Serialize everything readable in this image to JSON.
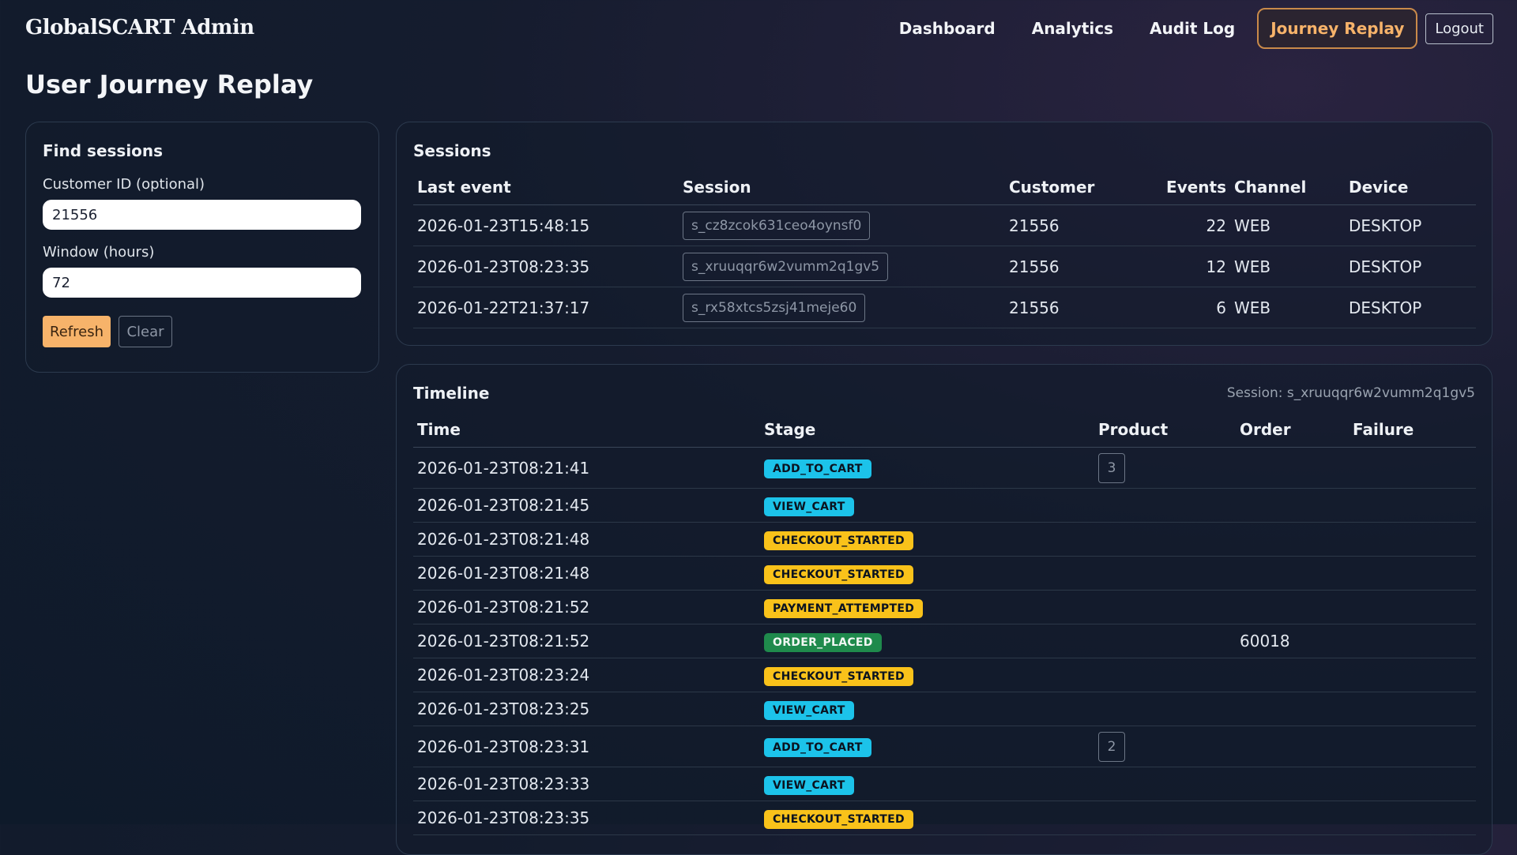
{
  "header": {
    "brand": "GlobalSCART Admin",
    "nav": [
      "Dashboard",
      "Analytics",
      "Audit Log",
      "Journey Replay"
    ],
    "active": "Journey Replay",
    "logout": "Logout"
  },
  "page": {
    "title": "User Journey Replay"
  },
  "find": {
    "title": "Find sessions",
    "customer_label": "Customer ID (optional)",
    "customer_value": "21556",
    "window_label": "Window (hours)",
    "window_value": "72",
    "refresh": "Refresh",
    "clear": "Clear"
  },
  "sessions": {
    "title": "Sessions",
    "columns": [
      "Last event",
      "Session",
      "Customer",
      "Events",
      "Channel",
      "Device"
    ],
    "rows": [
      {
        "last": "2026-01-23T15:48:15",
        "session": "s_cz8zcok631ceo4oynsf0",
        "customer": "21556",
        "events": "22",
        "channel": "WEB",
        "device": "DESKTOP"
      },
      {
        "last": "2026-01-23T08:23:35",
        "session": "s_xruuqqr6w2vumm2q1gv5",
        "customer": "21556",
        "events": "12",
        "channel": "WEB",
        "device": "DESKTOP"
      },
      {
        "last": "2026-01-22T21:37:17",
        "session": "s_rx58xtcs5zsj41meje60",
        "customer": "21556",
        "events": "6",
        "channel": "WEB",
        "device": "DESKTOP"
      }
    ]
  },
  "timeline": {
    "title": "Timeline",
    "session_label": "Session: s_xruuqqr6w2vumm2q1gv5",
    "columns": [
      "Time",
      "Stage",
      "Product",
      "Order",
      "Failure"
    ],
    "rows": [
      {
        "time": "2026-01-23T08:21:41",
        "stage": "ADD_TO_CART",
        "color": "blue",
        "product": "3",
        "order": "",
        "failure": ""
      },
      {
        "time": "2026-01-23T08:21:45",
        "stage": "VIEW_CART",
        "color": "blue",
        "product": "",
        "order": "",
        "failure": ""
      },
      {
        "time": "2026-01-23T08:21:48",
        "stage": "CHECKOUT_STARTED",
        "color": "yellow",
        "product": "",
        "order": "",
        "failure": ""
      },
      {
        "time": "2026-01-23T08:21:48",
        "stage": "CHECKOUT_STARTED",
        "color": "yellow",
        "product": "",
        "order": "",
        "failure": ""
      },
      {
        "time": "2026-01-23T08:21:52",
        "stage": "PAYMENT_ATTEMPTED",
        "color": "yellow",
        "product": "",
        "order": "",
        "failure": ""
      },
      {
        "time": "2026-01-23T08:21:52",
        "stage": "ORDER_PLACED",
        "color": "green",
        "product": "",
        "order": "60018",
        "failure": ""
      },
      {
        "time": "2026-01-23T08:23:24",
        "stage": "CHECKOUT_STARTED",
        "color": "yellow",
        "product": "",
        "order": "",
        "failure": ""
      },
      {
        "time": "2026-01-23T08:23:25",
        "stage": "VIEW_CART",
        "color": "blue",
        "product": "",
        "order": "",
        "failure": ""
      },
      {
        "time": "2026-01-23T08:23:31",
        "stage": "ADD_TO_CART",
        "color": "blue",
        "product": "2",
        "order": "",
        "failure": ""
      },
      {
        "time": "2026-01-23T08:23:33",
        "stage": "VIEW_CART",
        "color": "blue",
        "product": "",
        "order": "",
        "failure": ""
      },
      {
        "time": "2026-01-23T08:23:35",
        "stage": "CHECKOUT_STARTED",
        "color": "yellow",
        "product": "",
        "order": "",
        "failure": ""
      }
    ]
  },
  "colors": {
    "accent": "#f7b36a",
    "stage_blue": "#1cc3ea",
    "stage_yellow": "#f9c21a",
    "stage_green": "#1f8a4c"
  }
}
